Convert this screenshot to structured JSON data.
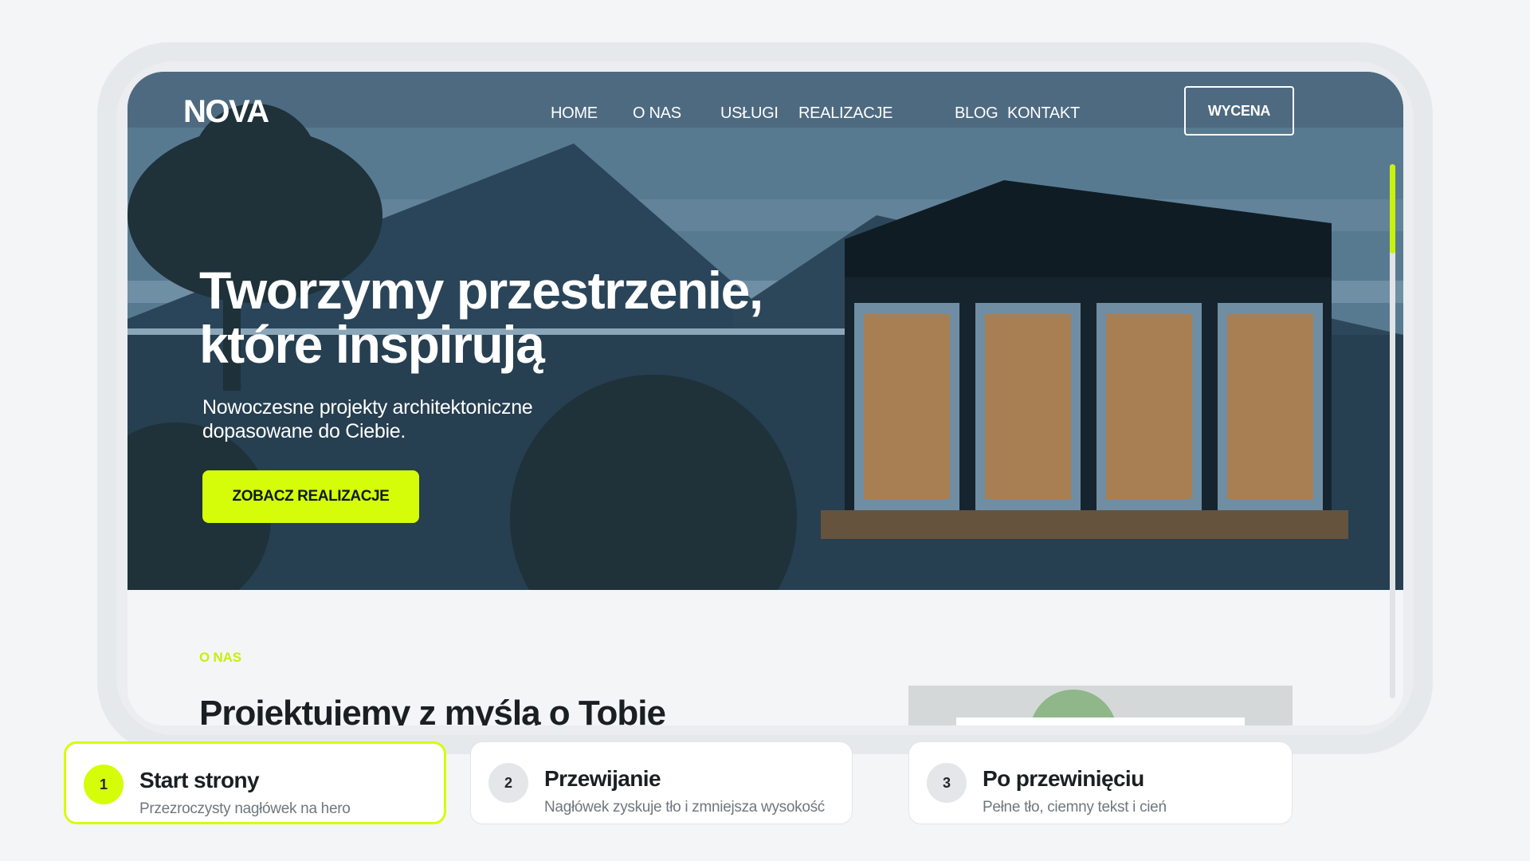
{
  "site": {
    "logo": "NOVA",
    "nav": [
      "HOME",
      "O NAS",
      "USŁUGI",
      "REALIZACJE",
      "BLOG",
      "KONTAKT"
    ],
    "cta_outline": "WYCENA",
    "hero": {
      "title_line1": "Tworzymy przestrzenie,",
      "title_line2": "które inspirują",
      "subtitle_line1": "Nowoczesne projekty architektoniczne",
      "subtitle_line2": "dopasowane do Ciebie.",
      "button": "ZOBACZ REALIZACJE"
    },
    "about": {
      "eyebrow": "O NAS",
      "title": "Projektujemy z myślą o Tobie"
    }
  },
  "steps": [
    {
      "num": "1",
      "title": "Start strony",
      "desc": "Przezroczysty nagłówek na hero",
      "active": true
    },
    {
      "num": "2",
      "title": "Przewijanie",
      "desc": "Nagłówek zyskuje tło i zmniejsza wysokość",
      "active": false
    },
    {
      "num": "3",
      "title": "Po przewinięciu",
      "desc": "Pełne tło, ciemny tekst i cień",
      "active": false
    }
  ],
  "colors": {
    "accent": "#d5fd0a",
    "sky": "#587a91",
    "dark_navy": "#263f51",
    "wood": "#a87f52",
    "page_bg": "#f4f5f7"
  }
}
